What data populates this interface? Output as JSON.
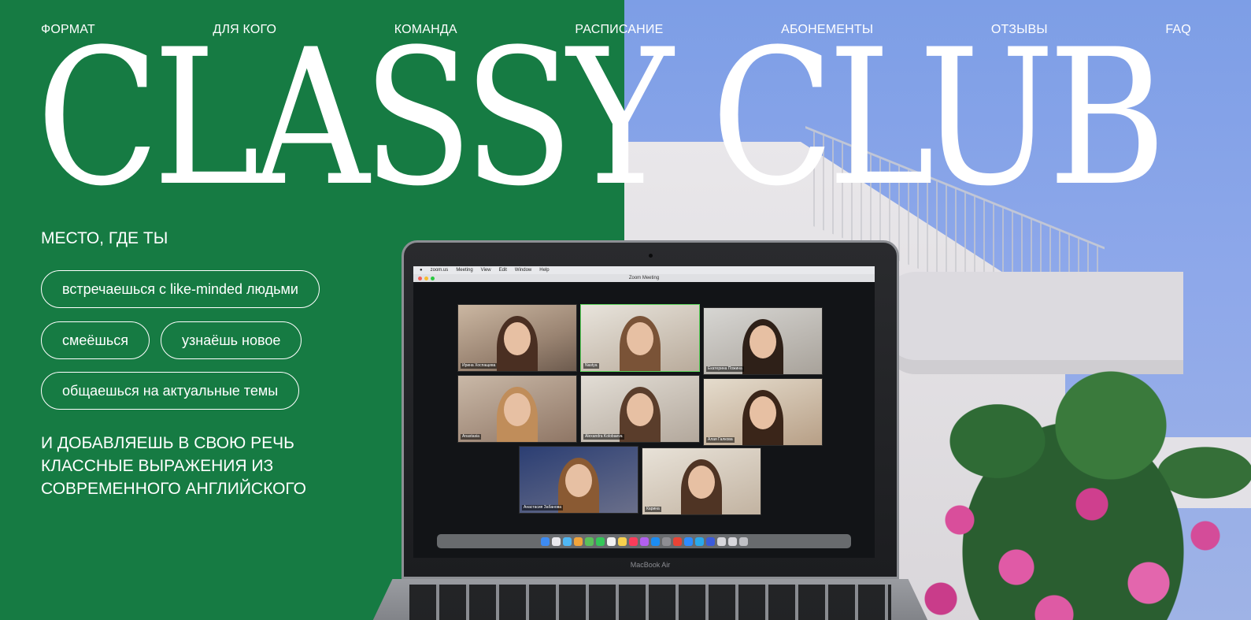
{
  "nav": {
    "items": [
      {
        "label": "ФОРМАТ"
      },
      {
        "label": "ДЛЯ КОГО"
      },
      {
        "label": "КОМАНДА"
      },
      {
        "label": "РАСПИСАНИЕ"
      },
      {
        "label": "АБОНЕМЕНТЫ"
      },
      {
        "label": "ОТЗЫВЫ"
      },
      {
        "label": "FAQ"
      }
    ]
  },
  "hero": {
    "title": "CLASSY CLUB",
    "intro": "МЕСТО, ГДЕ ТЫ",
    "pills": [
      "встречаешься с like-minded людьми",
      "смеёшься",
      "узнаёшь новое",
      "общаешься на актуальные темы"
    ],
    "outro": "И ДОБАВЛЯЕШЬ В СВОЮ РЕЧЬ КЛАССНЫЕ ВЫРАЖЕНИЯ ИЗ СОВРЕМЕННОГО АНГЛИЙСКОГО"
  },
  "colors": {
    "green": "#167b43",
    "sky": "#8ea8ea",
    "text": "#ffffff"
  },
  "photo": {
    "menubar": [
      "zoom.us",
      "Meeting",
      "View",
      "Edit",
      "Window",
      "Help"
    ],
    "window_title": "Zoom Meeting",
    "participants": [
      "Ирина Хоспащева",
      "Nastya",
      "Екатерина Пожина",
      "Anastasia",
      "Alexandra Kolobaeva",
      "Алая Галкова",
      "Анастасия Забанова",
      "Карина"
    ],
    "laptop_label": "MacBook Air"
  }
}
